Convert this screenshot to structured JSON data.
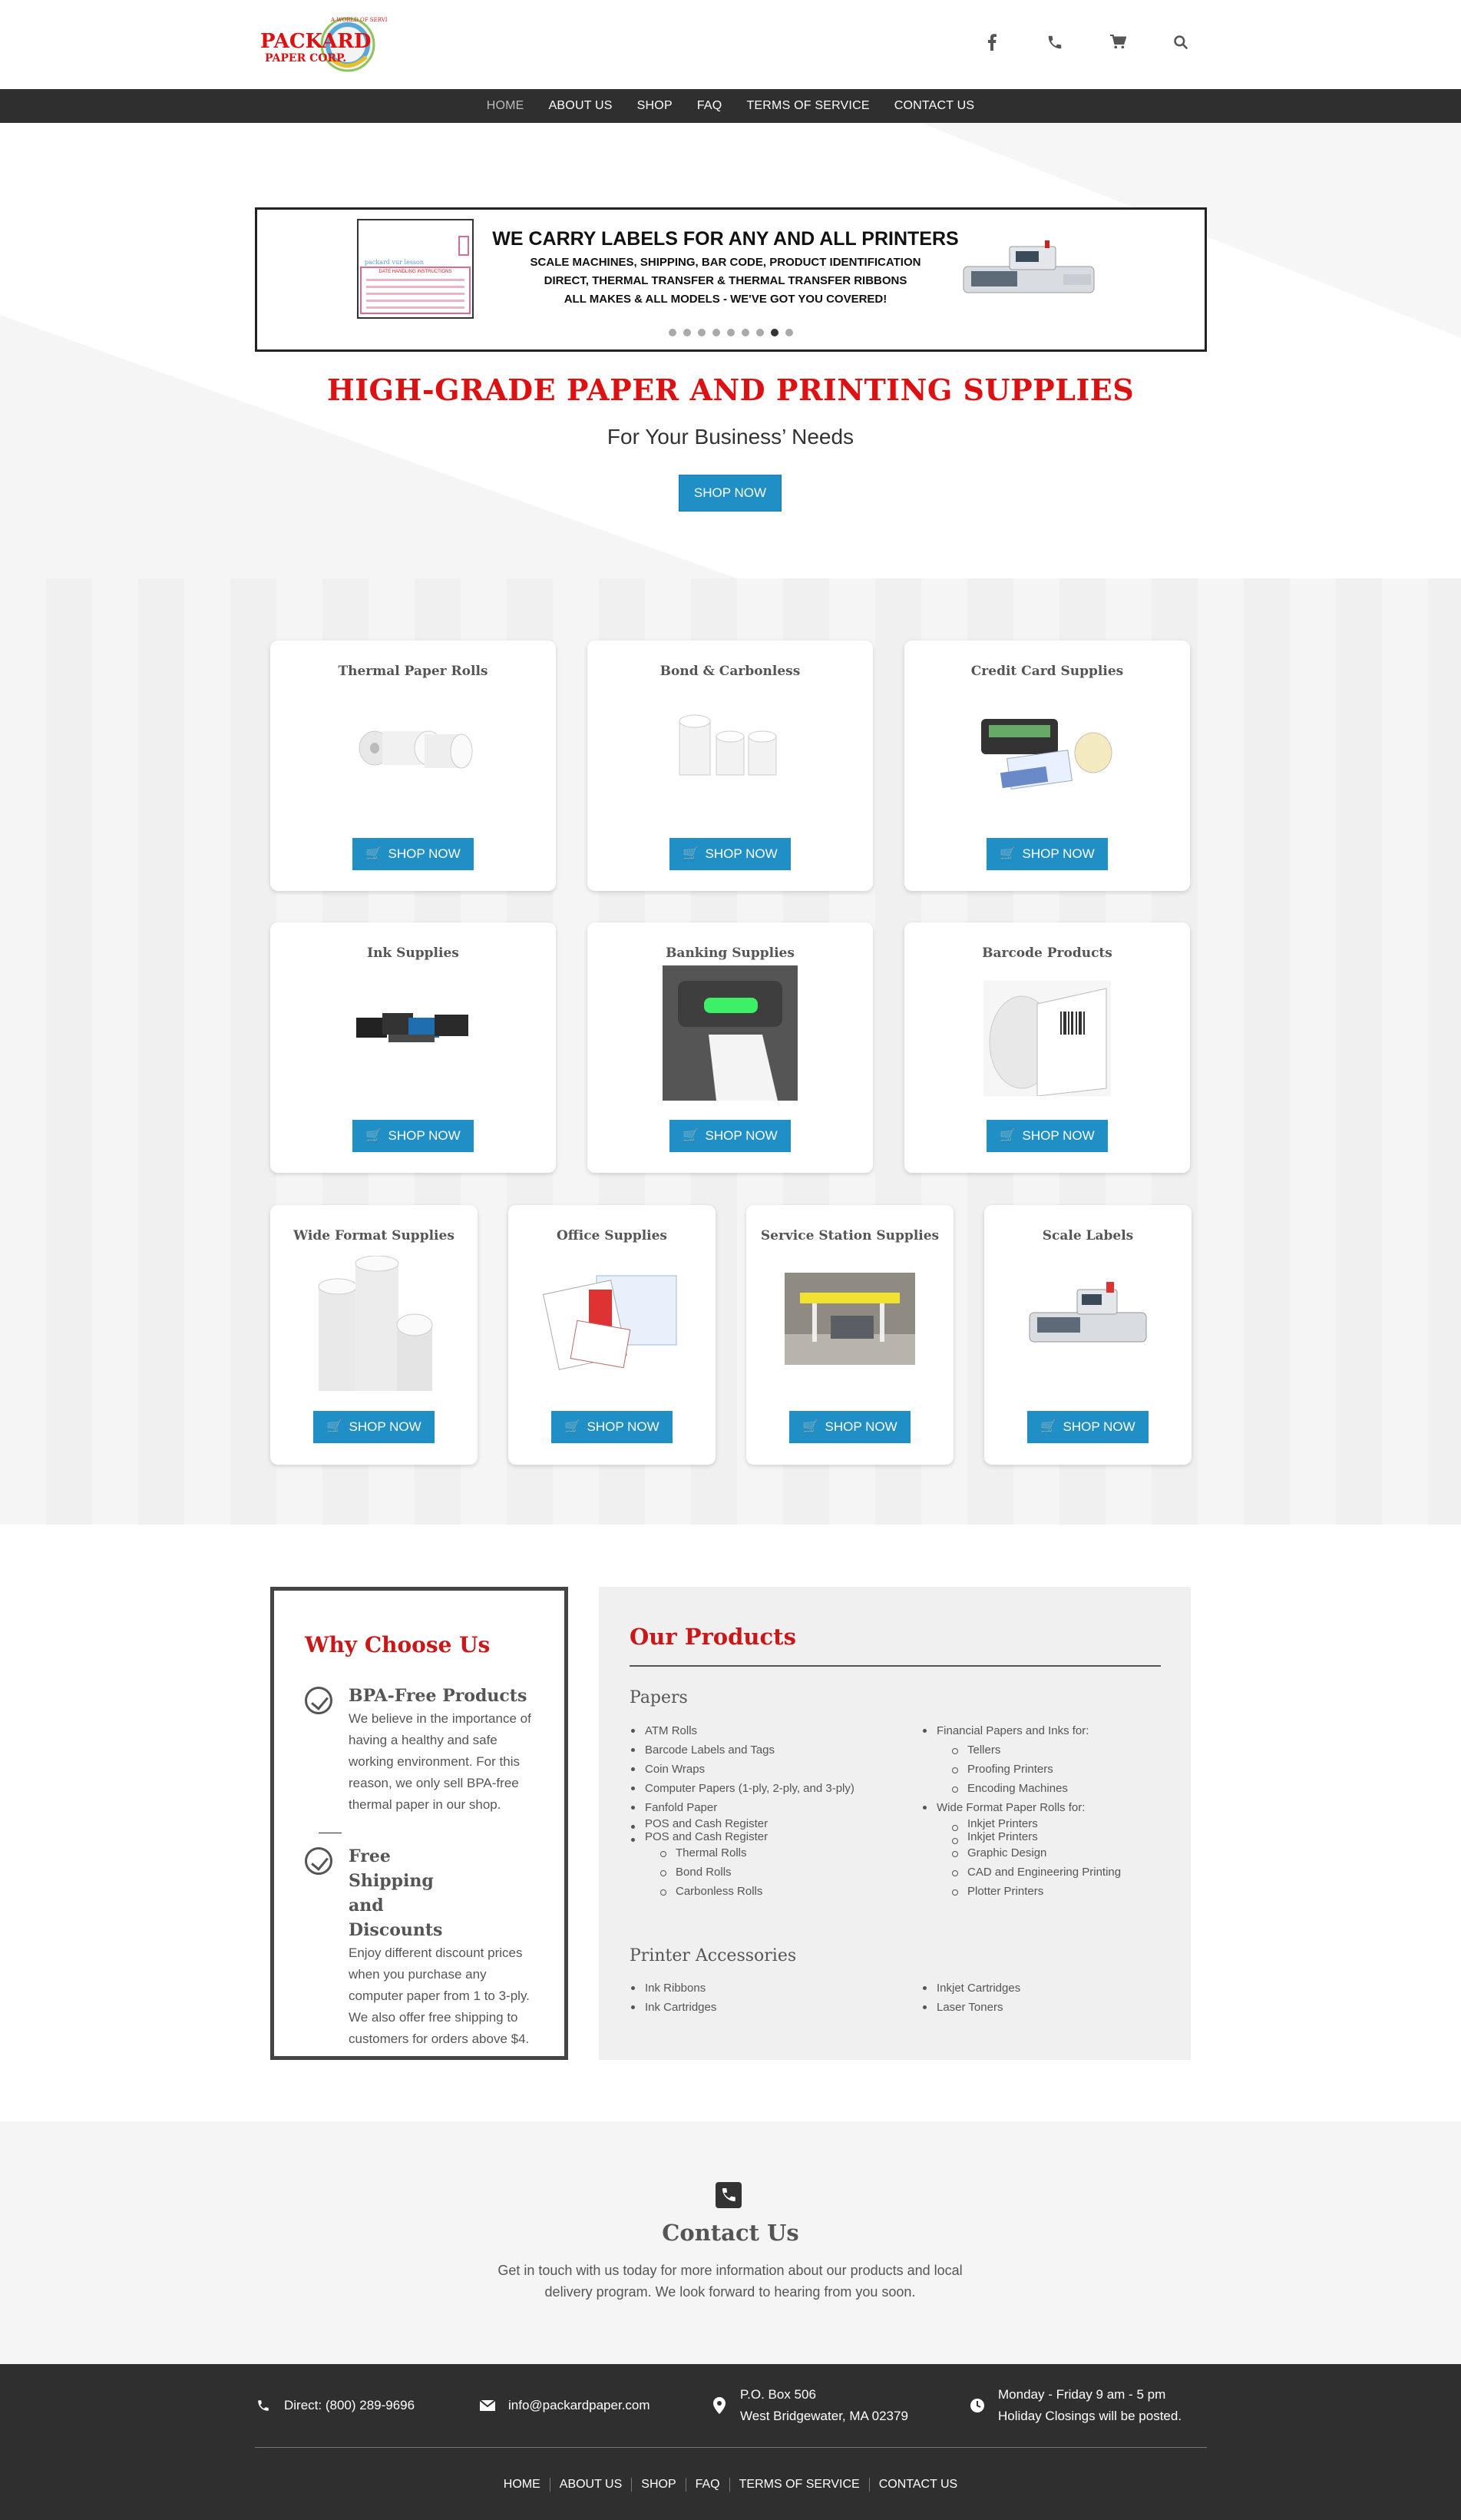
{
  "brand": {
    "logo_line1": "PACKARD",
    "logo_line2": "PAPER CORP.",
    "logo_arc": "A WORLD OF SERVICE"
  },
  "header_icons": [
    "facebook-icon",
    "phone-icon",
    "cart-icon",
    "search-icon"
  ],
  "nav": {
    "items": [
      "HOME",
      "ABOUT US",
      "SHOP",
      "FAQ",
      "TERMS OF SERVICE",
      "CONTACT US"
    ],
    "active": "HOME"
  },
  "slider": {
    "title": "WE CARRY LABELS FOR ANY AND ALL PRINTERS",
    "line1": "SCALE MACHINES, SHIPPING, BAR CODE, PRODUCT IDENTIFICATION",
    "line2": "DIRECT, THERMAL TRANSFER & THERMAL TRANSFER RIBBONS",
    "line3": "ALL MAKES & ALL MODELS - WE'VE GOT YOU COVERED!",
    "doc_text": "packard vur lesson",
    "doc_caption": "DATE HANDLING INSTRUCTIONS",
    "dot_count": 9,
    "active_dot": 8
  },
  "hero": {
    "title": "HIGH-GRADE PAPER AND PRINTING SUPPLIES",
    "subtitle": "For Your Business’ Needs",
    "button": "SHOP NOW"
  },
  "categories": [
    {
      "title": "Thermal Paper Rolls",
      "button": "SHOP NOW"
    },
    {
      "title": "Bond & Carbonless",
      "button": "SHOP NOW"
    },
    {
      "title": "Credit Card Supplies",
      "button": "SHOP NOW"
    },
    {
      "title": "Ink Supplies",
      "button": "SHOP NOW"
    },
    {
      "title": "Banking Supplies",
      "button": "SHOP NOW"
    },
    {
      "title": "Barcode Products",
      "button": "SHOP NOW"
    },
    {
      "title": "Wide Format Supplies",
      "button": "SHOP NOW"
    },
    {
      "title": "Office Supplies",
      "button": "SHOP NOW"
    },
    {
      "title": "Service Station Supplies",
      "button": "SHOP NOW"
    },
    {
      "title": "Scale Labels",
      "button": "SHOP NOW"
    }
  ],
  "why": {
    "title": "Why Choose Us",
    "items": [
      {
        "heading": "BPA-Free Products",
        "text": "We believe in the importance of having a healthy and safe working environment. For this reason, we only sell BPA-free thermal paper in our shop."
      },
      {
        "heading": "Free Shipping and Discounts",
        "text": "Enjoy different discount prices when you purchase any computer paper from 1 to 3-ply. We also offer free shipping to customers for orders above $4."
      }
    ]
  },
  "our_products": {
    "title": "Our Products",
    "papers_heading": "Papers",
    "papers_col1": [
      "ATM Rolls",
      "Barcode Labels and Tags",
      "Coin Wraps",
      "Computer Papers (1-ply, 2-ply, and 3-ply)",
      "Fanfold Paper",
      "POS and Cash Register",
      "POS and Cash Register"
    ],
    "papers_col1_sub": [
      "Thermal Rolls",
      "Bond Rolls",
      "Carbonless Rolls"
    ],
    "papers_col2_a": "Financial Papers and Inks for:",
    "papers_col2_a_sub": [
      "Tellers",
      "Proofing Printers",
      "Encoding Machines"
    ],
    "papers_col2_b": "Wide Format Paper Rolls for:",
    "papers_col2_b_sub": [
      "Inkjet Printers",
      "Inkjet Printers",
      "Graphic Design",
      "CAD and Engineering Printing",
      "Plotter Printers"
    ],
    "accessories_heading": "Printer Accessories",
    "acc_col1": [
      "Ink Ribbons",
      "Ink Cartridges"
    ],
    "acc_col2": [
      "Inkjet Cartridges",
      "Laser Toners"
    ]
  },
  "contact": {
    "title": "Contact Us",
    "text": "Get in touch with us today for more information about our products and local delivery program. We look forward to hearing from you soon."
  },
  "footer": {
    "phone": "Direct: (800) 289-9696",
    "email": "info@packardpaper.com",
    "address1": "P.O. Box 506",
    "address2": "West Bridgewater, MA 02379",
    "hours1": "Monday - Friday 9 am - 5 pm",
    "hours2": "Holiday Closings will be posted.",
    "nav": [
      "HOME",
      "ABOUT US",
      "SHOP",
      "FAQ",
      "TERMS OF SERVICE",
      "CONTACT US"
    ]
  },
  "colors": {
    "accent": "#1f8fc6",
    "headline_red": "#d11111",
    "nav_bg": "#2f2f2f"
  }
}
